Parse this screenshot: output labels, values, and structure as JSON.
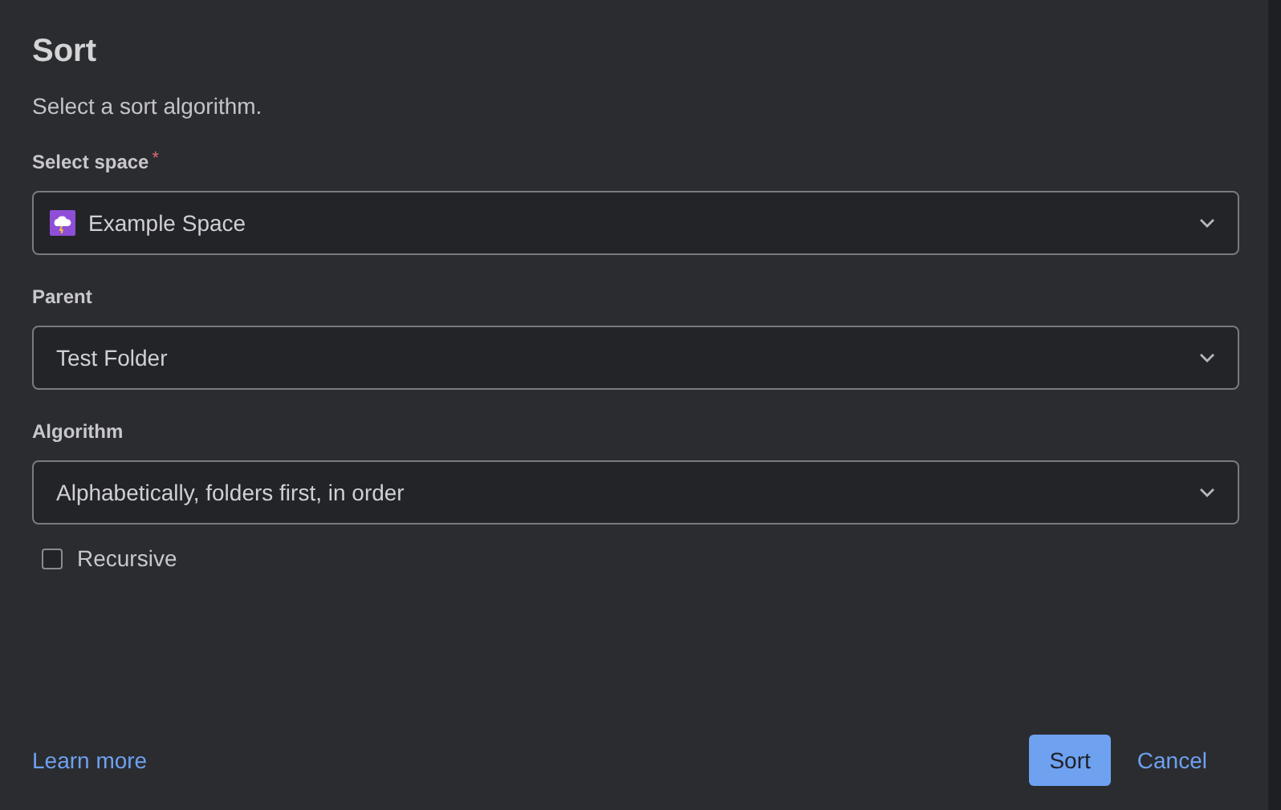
{
  "dialog": {
    "title": "Sort",
    "description": "Select a sort algorithm."
  },
  "fields": [
    {
      "label": "Select space",
      "required_mark": "*",
      "value": "Example Space",
      "icon": true
    },
    {
      "label": "Parent",
      "value": "Test Folder",
      "icon": false
    },
    {
      "label": "Algorithm",
      "value": "Alphabetically, folders first, in order",
      "icon": false
    }
  ],
  "recursive": {
    "label": "Recursive",
    "checked": false
  },
  "footer": {
    "link": "Learn more",
    "buttons": [
      {
        "label": "Sort",
        "kind": "primary"
      },
      {
        "label": "Cancel",
        "kind": "link"
      }
    ]
  }
}
